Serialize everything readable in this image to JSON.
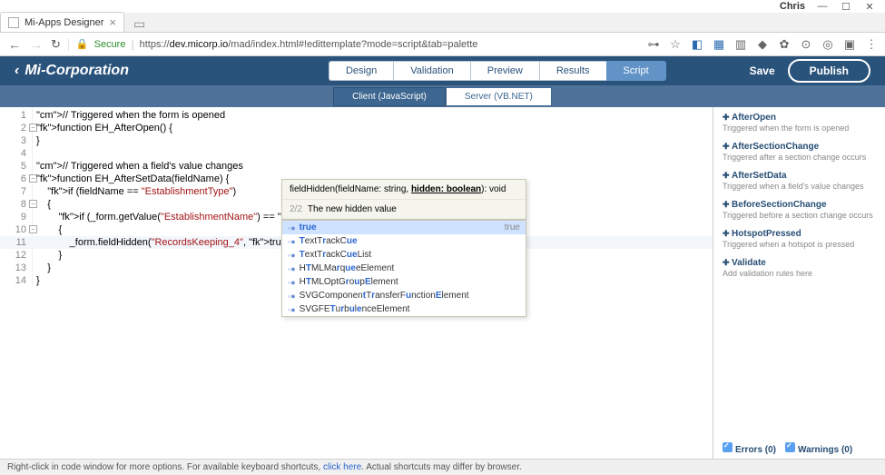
{
  "window": {
    "user": "Chris",
    "min": "—",
    "max": "☐",
    "close": "✕"
  },
  "browser": {
    "tab_title": "Mi-Apps Designer",
    "secure_label": "Secure",
    "url_prefix": "https://",
    "url_host": "dev.micorp.io",
    "url_path": "/mad/index.html#!edittemplate?mode=script&tab=palette",
    "key_icon": "⊶",
    "star_icon": "☆"
  },
  "header": {
    "back": "‹",
    "brand": "Mi-Corporation",
    "tabs": {
      "design": "Design",
      "validation": "Validation",
      "preview": "Preview",
      "results": "Results",
      "script": "Script"
    },
    "save": "Save",
    "publish": "Publish"
  },
  "subtabs": {
    "client": "Client (JavaScript)",
    "server": "Server (VB.NET)"
  },
  "editor": {
    "lines": [
      "// Triggered when the form is opened",
      "function EH_AfterOpen() {",
      "}",
      "",
      "// Triggered when a field's value changes",
      "function EH_AfterSetData(fieldName) {",
      "    if (fieldName == \"EstablishmentType\")",
      "    {",
      "        if (_form.getValue(\"EstablishmentName\") == \"Ke",
      "        {",
      "            _form.fieldHidden(\"RecordsKeeping_4\", true);",
      "        }",
      "    }",
      "}"
    ],
    "line_count": 14
  },
  "signature": {
    "text_a": "fieldHidden(fieldName: string, ",
    "text_b": "hidden: boolean",
    "text_c": "): void",
    "counter": "2/2",
    "desc": "The new hidden value"
  },
  "autocomplete": {
    "items": [
      {
        "raw": "true",
        "hint": "true",
        "sel": true
      },
      {
        "raw": "TextTrackCue"
      },
      {
        "raw": "TextTrackCueList"
      },
      {
        "raw": "HTMLMarqueeElement"
      },
      {
        "raw": "HTMLOptGroupElement"
      },
      {
        "raw": "SVGComponentTransferFunctionElement"
      },
      {
        "raw": "SVGFETurbulenceElement"
      }
    ]
  },
  "palette": {
    "items": [
      {
        "t": "AfterOpen",
        "d": "Triggered when the form is opened"
      },
      {
        "t": "AfterSectionChange",
        "d": "Triggered after a section change occurs"
      },
      {
        "t": "AfterSetData",
        "d": "Triggered when a field's value changes"
      },
      {
        "t": "BeforeSectionChange",
        "d": "Triggered before a section change occurs"
      },
      {
        "t": "HotspotPressed",
        "d": "Triggered when a hotspot is pressed"
      },
      {
        "t": "Validate",
        "d": "Add validation rules here"
      }
    ],
    "errors": "Errors (0)",
    "warnings": "Warnings (0)"
  },
  "footer": {
    "a": "Right-click in code window for more options. For available keyboard shortcuts, ",
    "link": "click here",
    "b": ". Actual shortcuts may differ by browser."
  }
}
